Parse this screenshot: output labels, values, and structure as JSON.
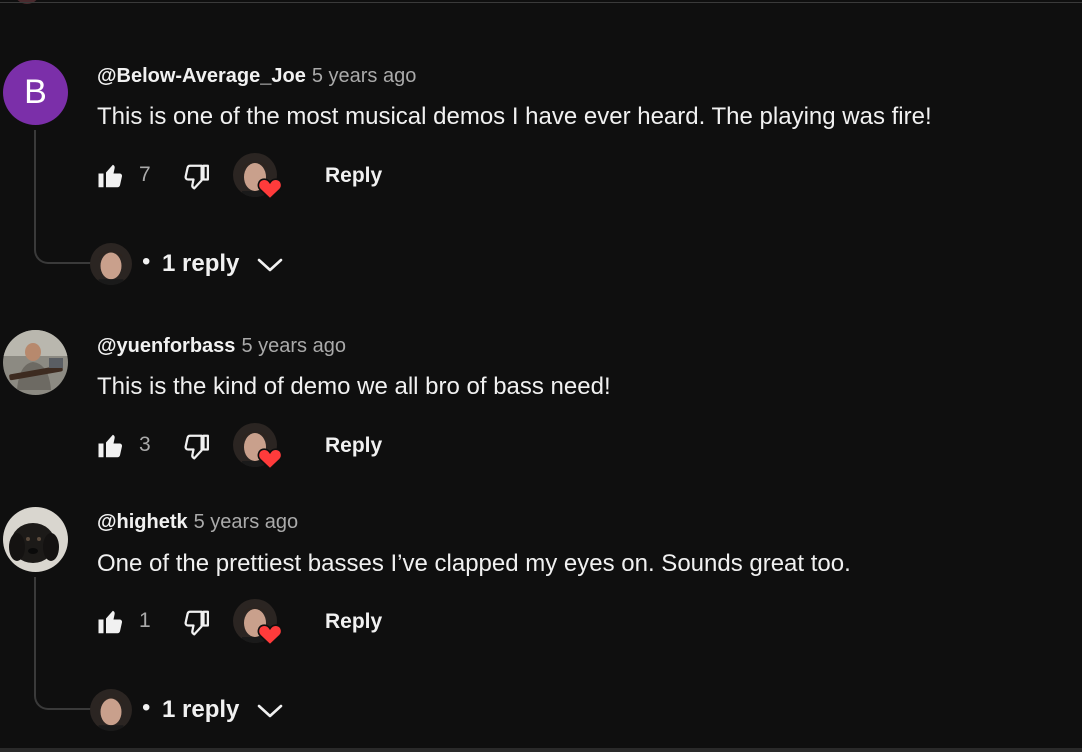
{
  "comments": [
    {
      "author": "@Below-Average_Joe",
      "time": "5 years ago",
      "text": "This is one of the most musical demos I have ever heard. The playing was fire!",
      "avatar_letter": "B",
      "avatar_color": "#7b2fa9",
      "likes": "7",
      "reply_label": "Reply",
      "replies": {
        "dot": "•",
        "label": "1 reply"
      }
    },
    {
      "author": "@yuenforbass",
      "time": "5 years ago",
      "text": "This is the kind of demo we all bro of bass need!",
      "likes": "3",
      "reply_label": "Reply"
    },
    {
      "author": "@highetk",
      "time": "5 years ago",
      "text": "One of the prettiest basses I’ve clapped my eyes on. Sounds great too.",
      "likes": "1",
      "reply_label": "Reply",
      "replies": {
        "dot": "•",
        "label": "1 reply"
      }
    }
  ],
  "icons": {
    "like": "thumbs-up-icon",
    "dislike": "thumbs-down-icon",
    "creator_heart": "heart-icon",
    "expand": "chevron-down-icon"
  },
  "colors": {
    "background": "#0f0f0f",
    "text": "#f1f1f1",
    "secondary_text": "#aaaaaa",
    "heart": "#ff3b3b",
    "divider": "#3a3a3a"
  }
}
